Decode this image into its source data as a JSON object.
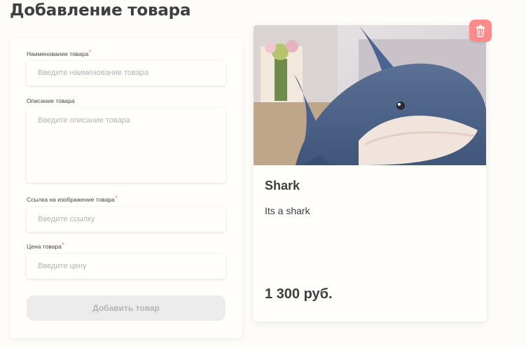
{
  "page": {
    "title": "Добавление товара"
  },
  "form": {
    "name": {
      "label": "Наименование товара",
      "required_mark": "*",
      "placeholder": "Введите наименование товара"
    },
    "description": {
      "label": "Описание товара",
      "placeholder": "Введите описание товара"
    },
    "image_link": {
      "label": "Ссылка на изображение товара",
      "required_mark": "*",
      "placeholder": "Введите ссылку"
    },
    "price": {
      "label": "Цена товара",
      "required_mark": "*",
      "placeholder": "Введите цену"
    },
    "submit_label": "Добавить товар"
  },
  "product": {
    "name": "Shark",
    "description": "Its a shark",
    "price": "1 300 руб.",
    "image_icon": "shark-plush-photo"
  },
  "icons": {
    "delete": "trash-icon"
  },
  "colors": {
    "accent_danger": "#ff8a8a",
    "background": "#fdfcf9",
    "text": "#3f3f3f",
    "placeholder": "#b4b4b4",
    "disabled_button": "#ececec"
  }
}
